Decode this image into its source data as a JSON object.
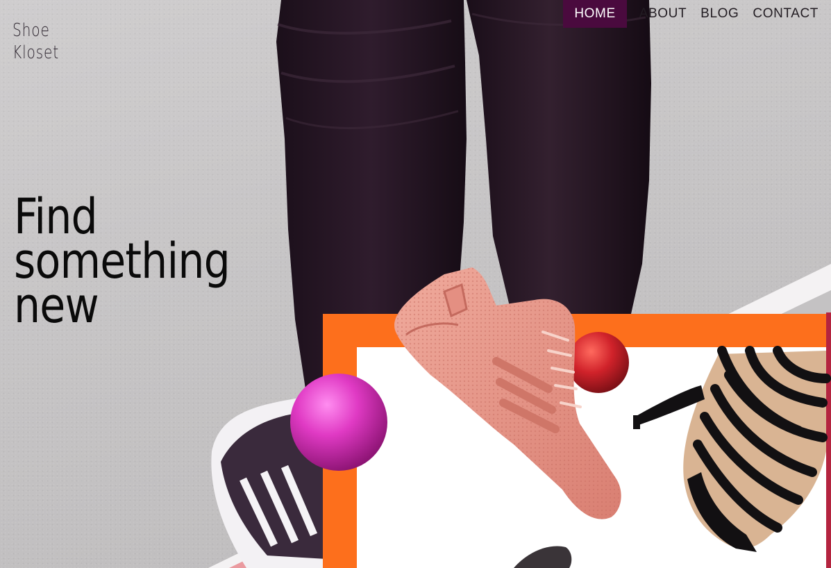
{
  "brand": {
    "line1": "Shoe",
    "line2": "Kloset"
  },
  "nav": {
    "items": [
      {
        "label": "HOME",
        "active": true
      },
      {
        "label": "ABOUT",
        "active": false
      },
      {
        "label": "BLOG",
        "active": false
      },
      {
        "label": "CONTACT",
        "active": false
      }
    ]
  },
  "hero": {
    "line1": "Find",
    "line2": "something",
    "line3": "new"
  },
  "colors": {
    "nav_active_bg": "#4a0a3e",
    "accent_orange": "#fd6f1c",
    "sphere_magenta": "#d92fb8",
    "sphere_red": "#d0222a",
    "sneaker_pink": "#e99a8c"
  }
}
